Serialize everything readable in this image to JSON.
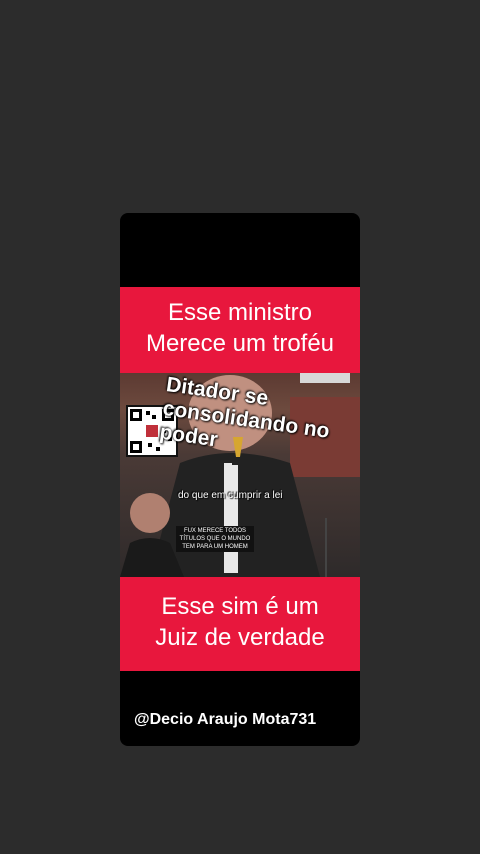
{
  "banner_top": {
    "line1": "Esse ministro",
    "line2": "Merece um troféu"
  },
  "overlay": {
    "big_caption": "Ditador se consolidando no poder",
    "small_caption": "do que em cumprir a lei",
    "box_caption": "FUX MERECE TODOS TÍTULOS QUE O MUNDO TEM PARA UM HOMEM"
  },
  "banner_bottom": {
    "line1": "Esse sim é um",
    "line2": "Juiz de verdade"
  },
  "handle": "@Decio Araujo Mota731",
  "colors": {
    "background": "#2c2c2c",
    "banner": "#e8173d",
    "card": "#000000"
  }
}
